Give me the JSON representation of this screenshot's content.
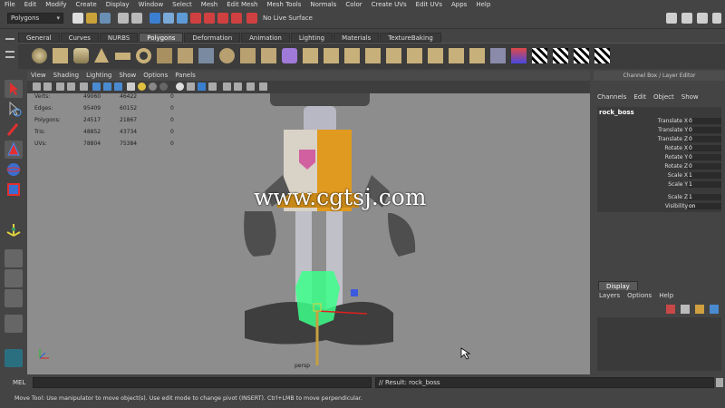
{
  "menu": [
    "File",
    "Edit",
    "Modify",
    "Create",
    "Display",
    "Window",
    "Select",
    "Mesh",
    "Edit Mesh",
    "Mesh Tools",
    "Normals",
    "Color",
    "Create UVs",
    "Edit UVs",
    "Apps",
    "Help"
  ],
  "mode_select": "Polygons",
  "live_surface": "No Live Surface",
  "shelf_tabs": [
    "General",
    "Curves",
    "NURBS",
    "Polygons",
    "Deformation",
    "Animation",
    "Lighting",
    "Materials",
    "TextureBaking"
  ],
  "active_shelf_tab": "Polygons",
  "viewport_menu": [
    "View",
    "Shading",
    "Lighting",
    "Show",
    "Options",
    "Panels"
  ],
  "hud": {
    "rows": [
      {
        "label": "Verts:",
        "a": "49060",
        "b": "46422",
        "c": "0"
      },
      {
        "label": "Edges:",
        "a": "95409",
        "b": "60152",
        "c": "0"
      },
      {
        "label": "Polygons:",
        "a": "24517",
        "b": "21867",
        "c": "0"
      },
      {
        "label": "Tris:",
        "a": "48852",
        "b": "43734",
        "c": "0"
      },
      {
        "label": "UVs:",
        "a": "78804",
        "b": "75384",
        "c": "0"
      }
    ]
  },
  "camera_label": "persp",
  "watermark": "www.cgtsj.com",
  "channel_box": {
    "title": "Channel Box / Layer Editor",
    "menu": [
      "Channels",
      "Edit",
      "Object",
      "Show"
    ],
    "object_name": "rock_boss",
    "attributes": [
      {
        "name": "Translate X",
        "value": "0"
      },
      {
        "name": "Translate Y",
        "value": "0"
      },
      {
        "name": "Translate Z",
        "value": "0"
      },
      {
        "name": "Rotate X",
        "value": "0"
      },
      {
        "name": "Rotate Y",
        "value": "0"
      },
      {
        "name": "Rotate Z",
        "value": "0"
      },
      {
        "name": "Scale X",
        "value": "1"
      },
      {
        "name": "Scale Y",
        "value": "1"
      },
      {
        "name": "Scale Z",
        "value": "1"
      },
      {
        "name": "Visibility",
        "value": "on"
      }
    ]
  },
  "layer_editor": {
    "tab": "Display",
    "menu": [
      "Layers",
      "Options",
      "Help"
    ]
  },
  "command_line": {
    "label": "MEL",
    "result": "// Result: rock_boss"
  },
  "help_line": "Move Tool: Use manipulator to move object(s). Use edit mode to change pivot (INSERT). Ctrl+LMB to move perpendicular.",
  "colors": {
    "bg": "#444444",
    "viewport": "#8d8d8d",
    "active_tab": "#5a5a5a",
    "selection_green": "#3cff8a"
  }
}
